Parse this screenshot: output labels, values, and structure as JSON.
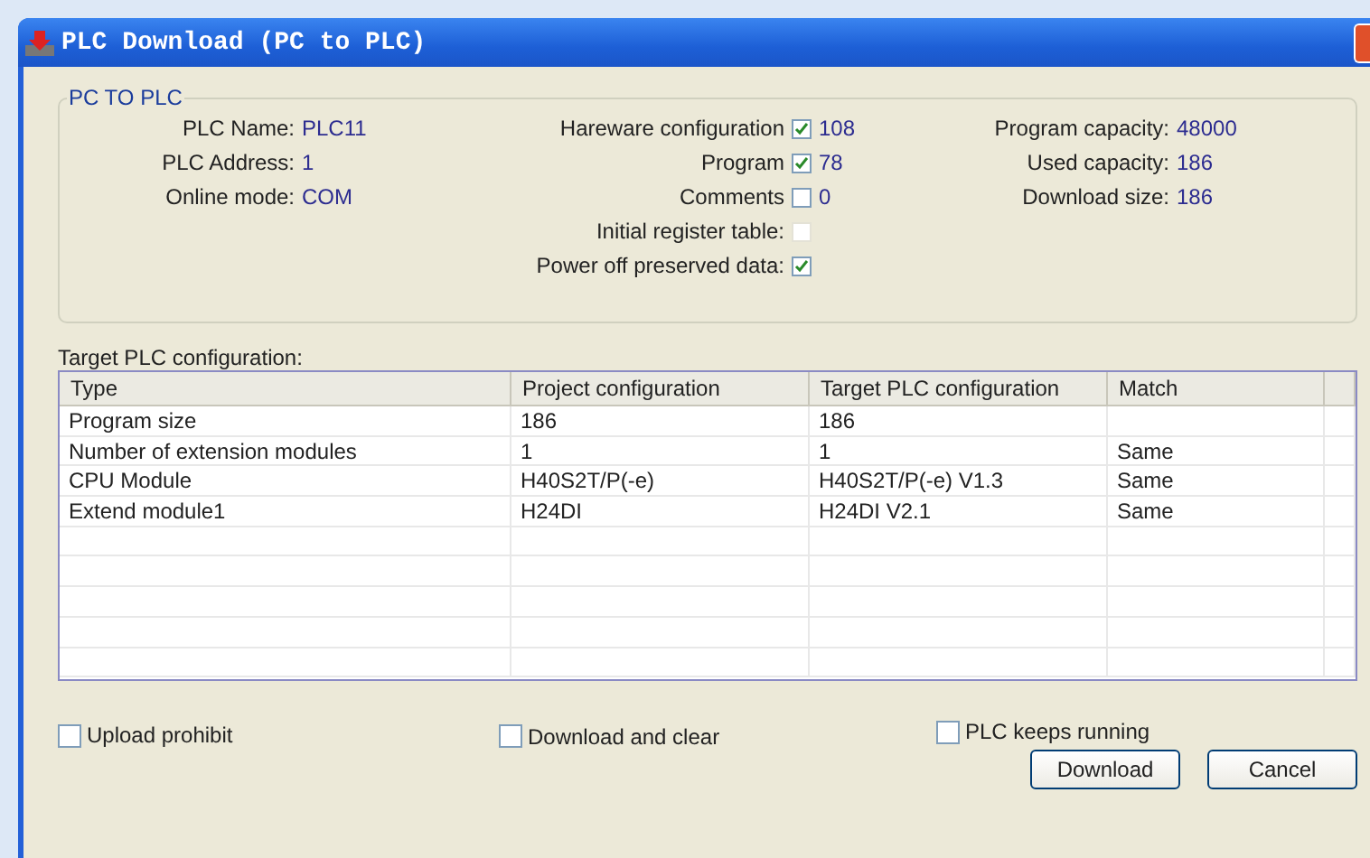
{
  "window": {
    "title": "PLC Download (PC to PLC)"
  },
  "pc_to_plc": {
    "title": "PC TO PLC",
    "info": [
      {
        "label": "PLC Name:",
        "value": "PLC11"
      },
      {
        "label": "PLC Address:",
        "value": "1"
      },
      {
        "label": "Online mode:",
        "value": "COM"
      }
    ],
    "parts": [
      {
        "label": "Hareware configuration",
        "checked": true,
        "disabled": false,
        "value": "108"
      },
      {
        "label": "Program",
        "checked": true,
        "disabled": false,
        "value": "78"
      },
      {
        "label": "Comments",
        "checked": false,
        "disabled": false,
        "value": "0"
      },
      {
        "label": "Initial register table:",
        "checked": false,
        "disabled": true
      },
      {
        "label": "Power off preserved data:",
        "checked": true,
        "disabled": false
      }
    ],
    "capacity": [
      {
        "label": "Program capacity:",
        "value": "48000"
      },
      {
        "label": "Used capacity:",
        "value": "186"
      },
      {
        "label": "Download size:",
        "value": "186"
      }
    ]
  },
  "table": {
    "caption": "Target PLC configuration:",
    "columns": [
      "Type",
      "Project configuration",
      "Target PLC configuration",
      "Match"
    ],
    "rows": [
      [
        "Program size",
        "186",
        "186",
        ""
      ],
      [
        "Number of extension modules",
        "1",
        "1",
        "Same"
      ],
      [
        "CPU Module",
        "H40S2T/P(-e)",
        "H40S2T/P(-e) V1.3",
        "Same"
      ],
      [
        "Extend module1",
        "H24DI",
        "H24DI V2.1",
        "Same"
      ]
    ]
  },
  "options": [
    {
      "label": "Upload prohibit",
      "checked": false
    },
    {
      "label": "Download and clear",
      "checked": false
    },
    {
      "label": "PLC keeps running",
      "checked": false
    }
  ],
  "buttons": [
    "Download",
    "Cancel"
  ]
}
